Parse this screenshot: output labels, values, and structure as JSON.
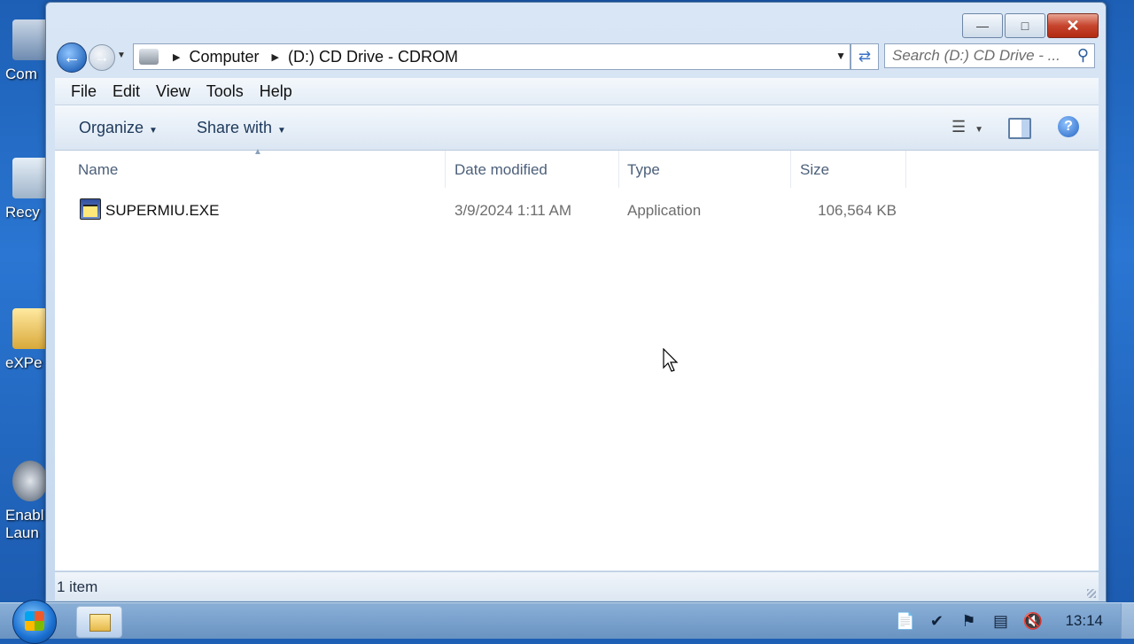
{
  "desktop": {
    "icons": [
      {
        "label": "Com",
        "icon": "computer-icon"
      },
      {
        "label": "Recy",
        "icon": "recycle-bin-icon"
      },
      {
        "label": "eXPe",
        "icon": "folder-icon"
      },
      {
        "label": "Enabl",
        "label2": "Laun",
        "icon": "app-launcher-icon"
      }
    ]
  },
  "window": {
    "caption_buttons": {
      "minimize": "—",
      "maximize": "□",
      "close": "✕"
    },
    "address": {
      "root": "Computer",
      "current": "(D:) CD Drive - CDROM"
    },
    "search_placeholder": "Search (D:) CD Drive - ...",
    "menu": [
      "File",
      "Edit",
      "View",
      "Tools",
      "Help"
    ],
    "commands": {
      "organize": "Organize",
      "share_with": "Share with"
    },
    "columns": {
      "name": "Name",
      "date_modified": "Date modified",
      "type": "Type",
      "size": "Size"
    },
    "files": [
      {
        "name": "SUPERMIU.EXE",
        "date_modified": "3/9/2024 1:11 AM",
        "type": "Application",
        "size": "106,564 KB"
      }
    ],
    "status": "1 item"
  },
  "taskbar": {
    "clock": "13:14"
  }
}
